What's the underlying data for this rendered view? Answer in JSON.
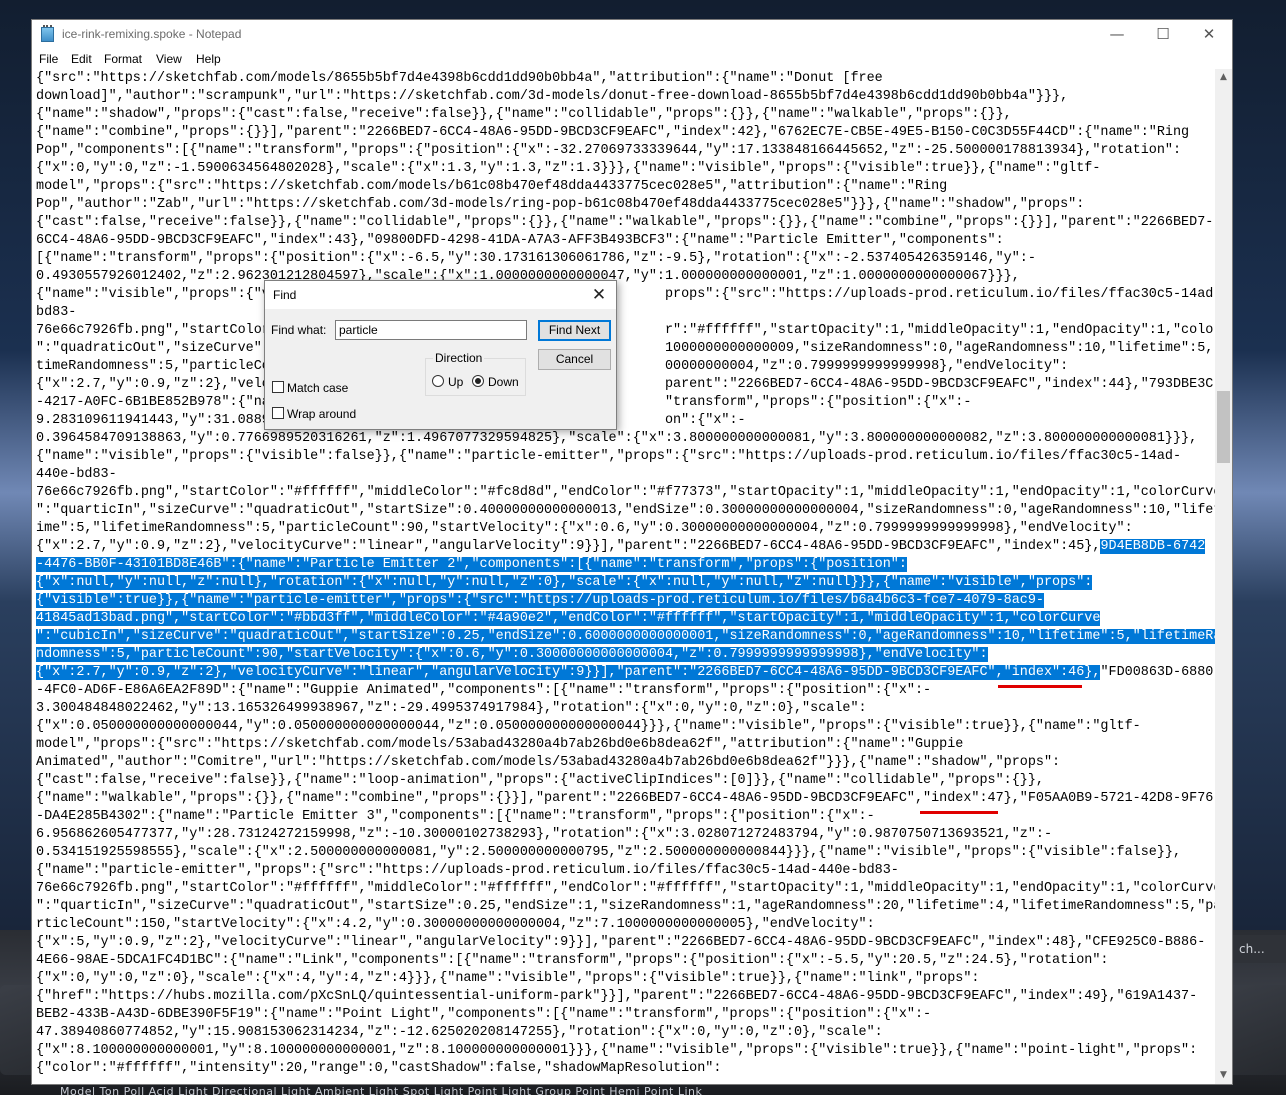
{
  "window": {
    "title": "ice-rink-remixing.spoke - Notepad",
    "minimize": "—",
    "maximize": "☐",
    "close": "✕"
  },
  "menu": {
    "file": "File",
    "edit": "Edit",
    "format": "Format",
    "view": "View",
    "help": "Help"
  },
  "editor": {
    "lines": [
      "{\"src\":\"https://sketchfab.com/models/8655b5bf7d4e4398b6cdd1dd90b0bb4a\",\"attribution\":{\"name\":\"Donut [free",
      "download]\",\"author\":\"scrampunk\",\"url\":\"https://sketchfab.com/3d-models/donut-free-download-8655b5bf7d4e4398b6cdd1dd90b0bb4a\"}}},",
      "{\"name\":\"shadow\",\"props\":{\"cast\":false,\"receive\":false}},{\"name\":\"collidable\",\"props\":{}},{\"name\":\"walkable\",\"props\":{}},",
      "{\"name\":\"combine\",\"props\":{}}],\"parent\":\"2266BED7-6CC4-48A6-95DD-9BCD3CF9EAFC\",\"index\":42},\"6762EC7E-CB5E-49E5-B150-C0C3D55F44CD\":{\"name\":\"Ring",
      "Pop\",\"components\":[{\"name\":\"transform\",\"props\":{\"position\":{\"x\":-32.27069733339644,\"y\":17.133848166445652,\"z\":-25.500000178813934},\"rotation\":",
      "{\"x\":0,\"y\":0,\"z\":-1.5900634564802028},\"scale\":{\"x\":1.3,\"y\":1.3,\"z\":1.3}}},{\"name\":\"visible\",\"props\":{\"visible\":true}},{\"name\":\"gltf-",
      "model\",\"props\":{\"src\":\"https://sketchfab.com/models/b61c08b470ef48dda4433775cec028e5\",\"attribution\":{\"name\":\"Ring",
      "Pop\",\"author\":\"Zab\",\"url\":\"https://sketchfab.com/3d-models/ring-pop-b61c08b470ef48dda4433775cec028e5\"}}},{\"name\":\"shadow\",\"props\":",
      "{\"cast\":false,\"receive\":false}},{\"name\":\"collidable\",\"props\":{}},{\"name\":\"walkable\",\"props\":{}},{\"name\":\"combine\",\"props\":{}}],\"parent\":\"2266BED7-",
      "6CC4-48A6-95DD-9BCD3CF9EAFC\",\"index\":43},\"09800DFD-4298-41DA-A7A3-AFF3B493BCF3\":{\"name\":\"Particle Emitter\",\"components\":",
      "[{\"name\":\"transform\",\"props\":{\"position\":{\"x\":-6.5,\"y\":30.173161306061786,\"z\":-9.5},\"rotation\":{\"x\":-2.537405426359146,\"y\":-",
      "0.4930557926012402,\"z\":2.962301212804597},\"scale\":{\"x\":1.0000000000000047,\"y\":1.000000000000001,\"z\":1.0000000000000067}}},",
      "{\"name\":\"visible\",\"props\":{\"v                                                 props\":{\"src\":\"https://uploads-prod.reticulum.io/files/ffac30c5-14ad-440e-",
      "bd83-",
      "76e66c7926fb.png\",\"startColor                                                 r\":\"#ffffff\",\"startOpacity\":1,\"middleOpacity\":1,\"endOpacity\":1,\"colorCurve",
      "\":\"quadraticOut\",\"sizeCurve\":                                                 1000000000000009,\"sizeRandomness\":0,\"ageRandomness\":10,\"lifetime\":5,\"life",
      "timeRandomness\":5,\"particleCo                                                 00000000004,\"z\":0.7999999999999998},\"endVelocity\":",
      "{\"x\":2.7,\"y\":0.9,\"z\":2},\"velo                                                 parent\":\"2266BED7-6CC4-48A6-95DD-9BCD3CF9EAFC\",\"index\":44},\"793DBE3C-7C65",
      "-4217-A0FC-6B1BE852B978\":{\"na                                                 \"transform\",\"props\":{\"position\":{\"x\":-",
      "9.283109611941443,\"y\":31.0889                                                 on\":{\"x\":-",
      "0.3964584709138863,\"y\":0.7766989520316261,\"z\":1.4967077329594825},\"scale\":{\"x\":3.800000000000081,\"y\":3.800000000000082,\"z\":3.800000000000081}}},",
      "{\"name\":\"visible\",\"props\":{\"visible\":false}},{\"name\":\"particle-emitter\",\"props\":{\"src\":\"https://uploads-prod.reticulum.io/files/ffac30c5-14ad-",
      "440e-bd83-",
      "76e66c7926fb.png\",\"startColor\":\"#ffffff\",\"middleColor\":\"#fc8d8d\",\"endColor\":\"#f77373\",\"startOpacity\":1,\"middleOpacity\":1,\"endOpacity\":1,\"colorCurve",
      "\":\"quarticIn\",\"sizeCurve\":\"quadraticOut\",\"startSize\":0.40000000000000013,\"endSize\":0.30000000000000004,\"sizeRandomness\":0,\"ageRandomness\":10,\"lifet",
      "ime\":5,\"lifetimeRandomness\":5,\"particleCount\":90,\"startVelocity\":{\"x\":0.6,\"y\":0.30000000000000004,\"z\":0.7999999999999998},\"endVelocity\":",
      "{\"x\":2.7,\"y\":0.9,\"z\":2},\"velocityCurve\":\"linear\",\"angularVelocity\":9}}],\"parent\":\"2266BED7-6CC4-48A6-95DD-9BCD3CF9EAFC\",\"index\":45},",
      "",
      "",
      "",
      "",
      "",
      "",
      "{\"name\":\"Guppie Animated\",\"components\":[{\"name\":\"transform\",\"props\":{\"position\":{\"x\":-",
      "3.300484848022462,\"y\":13.165326499938967,\"z\":-29.4995374917984},\"rotation\":{\"x\":0,\"y\":0,\"z\":0},\"scale\":",
      "{\"x\":0.050000000000000044,\"y\":0.050000000000000044,\"z\":0.050000000000000044}}},{\"name\":\"visible\",\"props\":{\"visible\":true}},{\"name\":\"gltf-",
      "model\",\"props\":{\"src\":\"https://sketchfab.com/models/53abad43280a4b7ab26bd0e6b8dea62f\",\"attribution\":{\"name\":\"Guppie",
      "Animated\",\"author\":\"Comitre\",\"url\":\"https://sketchfab.com/models/53abad43280a4b7ab26bd0e6b8dea62f\"}}},{\"name\":\"shadow\",\"props\":",
      "{\"cast\":false,\"receive\":false}},{\"name\":\"loop-animation\",\"props\":{\"activeClipIndices\":[0]}},{\"name\":\"collidable\",\"props\":{}},",
      "{\"name\":\"walkable\",\"props\":{}},{\"name\":\"combine\",\"props\":{}}],\"parent\":\"2266BED7-6CC4-48A6-95DD-9BCD3CF9EAFC\",\"index\":47},\"F05AA0B9-5721-42D8-9F76",
      "-DA4E285B4302\":{\"name\":\"Particle Emitter 3\",\"components\":[{\"name\":\"transform\",\"props\":{\"position\":{\"x\":-",
      "6.956862605477377,\"y\":28.73124272159998,\"z\":-10.30000102738293},\"rotation\":{\"x\":3.028071272483794,\"y\":0.9870750713693521,\"z\":-",
      "0.534151925598555},\"scale\":{\"x\":2.500000000000081,\"y\":2.500000000000795,\"z\":2.500000000000844}}},{\"name\":\"visible\",\"props\":{\"visible\":false}},",
      "{\"name\":\"particle-emitter\",\"props\":{\"src\":\"https://uploads-prod.reticulum.io/files/ffac30c5-14ad-440e-bd83-",
      "76e66c7926fb.png\",\"startColor\":\"#ffffff\",\"middleColor\":\"#ffffff\",\"endColor\":\"#ffffff\",\"startOpacity\":1,\"middleOpacity\":1,\"endOpacity\":1,\"colorCurve",
      "\":\"quarticIn\",\"sizeCurve\":\"quadraticOut\",\"startSize\":0.25,\"endSize\":1,\"sizeRandomness\":1,\"ageRandomness\":20,\"lifetime\":4,\"lifetimeRandomness\":5,\"pa",
      "rticleCount\":150,\"startVelocity\":{\"x\":4.2,\"y\":0.30000000000000004,\"z\":7.1000000000000005},\"endVelocity\":",
      "{\"x\":5,\"y\":0.9,\"z\":2},\"velocityCurve\":\"linear\",\"angularVelocity\":9}}],\"parent\":\"2266BED7-6CC4-48A6-95DD-9BCD3CF9EAFC\",\"index\":48},\"CFE925C0-B886-",
      "4E66-98AE-5DCA1FC4D1BC\":{\"name\":\"Link\",\"components\":[{\"name\":\"transform\",\"props\":{\"position\":{\"x\":-5.5,\"y\":20.5,\"z\":24.5},\"rotation\":",
      "{\"x\":0,\"y\":0,\"z\":0},\"scale\":{\"x\":4,\"y\":4,\"z\":4}}},{\"name\":\"visible\",\"props\":{\"visible\":true}},{\"name\":\"link\",\"props\":",
      "{\"href\":\"https://hubs.mozilla.com/pXcSnLQ/quintessential-uniform-park\"}}],\"parent\":\"2266BED7-6CC4-48A6-95DD-9BCD3CF9EAFC\",\"index\":49},\"619A1437-",
      "BEB2-433B-A43D-6DBE390F5F19\":{\"name\":\"Point Light\",\"components\":[{\"name\":\"transform\",\"props\":{\"position\":{\"x\":-",
      "47.38940860774852,\"y\":15.908153062314234,\"z\":-12.625020208147255},\"rotation\":{\"x\":0,\"y\":0,\"z\":0},\"scale\":",
      "{\"x\":8.100000000000001,\"y\":8.100000000000001,\"z\":8.100000000000001}}},{\"name\":\"visible\",\"props\":{\"visible\":true}},{\"name\":\"point-light\",\"props\":",
      "{\"color\":\"#ffffff\",\"intensity\":20,\"range\":0,\"castShadow\":false,\"shadowMapResolution\":"
    ],
    "highlight_lead": "{\"x\":2.7,\"y\":0.9,\"z\":2},\"velocityCurve\":\"linear\",\"angularVelocity\":9}}],\"parent\":\"2266BED7-6CC4-48A6-95DD-9BCD3CF9EAFC\",\"index\":45},",
    "highlight": [
      "9D4EB8DB-6742",
      "-4476-BB0F-43101BD8E46B\":{\"name\":\"Particle Emitter 2\",\"components\":[{\"name\":\"transform\",\"props\":{\"position\":",
      "{\"x\":null,\"y\":null,\"z\":null},\"rotation\":{\"x\":null,\"y\":null,\"z\":0},\"scale\":{\"x\":null,\"y\":null,\"z\":null}}},{\"name\":\"visible\",\"props\":",
      "{\"visible\":true}},{\"name\":\"particle-emitter\",\"props\":{\"src\":\"https://uploads-prod.reticulum.io/files/b6a4b6c3-fce7-4079-8ac9-",
      "41845ad13bad.png\",\"startColor\":\"#bbd3ff\",\"middleColor\":\"#4a90e2\",\"endColor\":\"#ffffff\",\"startOpacity\":1,\"middleOpacity\":1,\"colorCurve",
      "\":\"cubicIn\",\"sizeCurve\":\"quadraticOut\",\"startSize\":0.25,\"endSize\":0.6000000000000001,\"sizeRandomness\":0,\"ageRandomness\":10,\"lifetime\":5,\"lifetimeRa",
      "ndomness\":5,\"particleCount\":90,\"startVelocity\":{\"x\":0.6,\"y\":0.30000000000000004,\"z\":0.7999999999999998},\"endVelocity\":",
      "{\"x\":2.7,\"y\":0.9,\"z\":2},\"velocityCurve\":\"linear\",\"angularVelocity\":9}}],\"parent\":\"2266BED7-6CC4-48A6-95DD-9BCD3CF9EAFC\",\"index\":46},"
    ],
    "highlight_tail": "\"FD00863D-6880",
    "after_tail_line": "-4FC0-AD6F-E86A6EA2F89D\":"
  },
  "find": {
    "title": "Find",
    "label": "Find what:",
    "value": "particle",
    "find_next": "Find Next",
    "cancel": "Cancel",
    "direction": "Direction",
    "up": "Up",
    "down": "Down",
    "match_case": "Match case",
    "wrap_around": "Wrap around"
  },
  "background": {
    "search_text": "ch...",
    "tile_labels": "Model    Ton Poll    Acid Light    Directional Light    Ambient Light    Spot Light    Point Light    Group Point    Hemi Point    Link"
  }
}
